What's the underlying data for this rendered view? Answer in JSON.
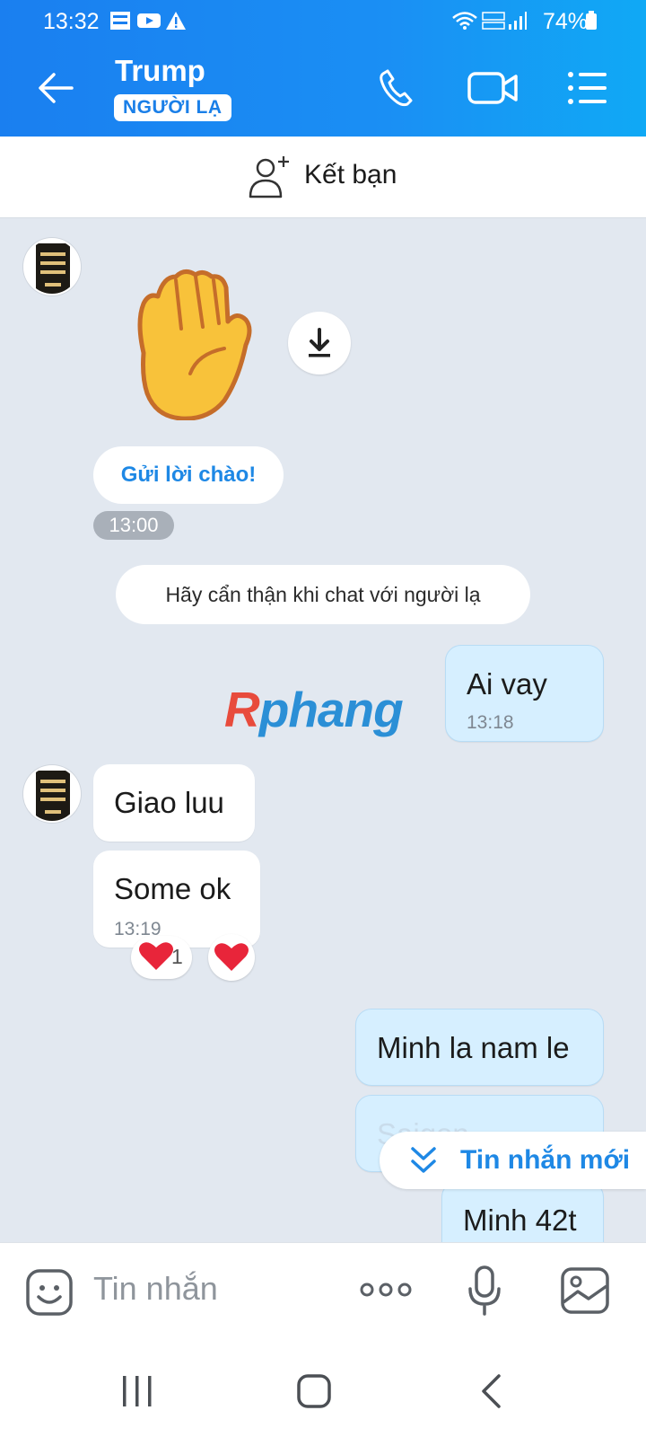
{
  "status_bar": {
    "time": "13:32",
    "battery": "74%",
    "icons": [
      "bao-moi-icon",
      "youtube-icon",
      "warning-icon",
      "wifi-icon",
      "volte-icon",
      "signal-icon",
      "battery-icon"
    ]
  },
  "header": {
    "title": "Trump",
    "badge": "NGƯỜI LẠ",
    "icons": [
      "back-arrow-icon",
      "phone-icon",
      "video-icon",
      "menu-list-icon"
    ]
  },
  "add_friend": {
    "label": "Kết bạn"
  },
  "chat": {
    "greeting_button": "Gửi lời chào!",
    "greeting_time": "13:00",
    "warning": "Hãy cẩn thận khi chat với người lạ",
    "watermark": {
      "r": "R",
      "rest": "phang"
    },
    "messages": [
      {
        "from": "me",
        "text": "Ai vay",
        "time": "13:18"
      },
      {
        "from": "them",
        "text": "Giao luu",
        "time": ""
      },
      {
        "from": "them",
        "text": "Some ok",
        "time": "13:19"
      },
      {
        "from": "me",
        "text": "Minh la nam le",
        "time": ""
      },
      {
        "from": "me",
        "text": "Saigon ...",
        "time": ""
      },
      {
        "from": "me",
        "text": "Minh 42t",
        "time": ""
      }
    ],
    "reactions": {
      "count": "1"
    },
    "new_messages_label": "Tin nhắn mới"
  },
  "composer": {
    "placeholder": "Tin nhắn"
  },
  "colors": {
    "accent": "#1a8ff4",
    "my_bubble": "#d6efff",
    "background": "#e2e8f0",
    "link": "#1e88e5"
  }
}
